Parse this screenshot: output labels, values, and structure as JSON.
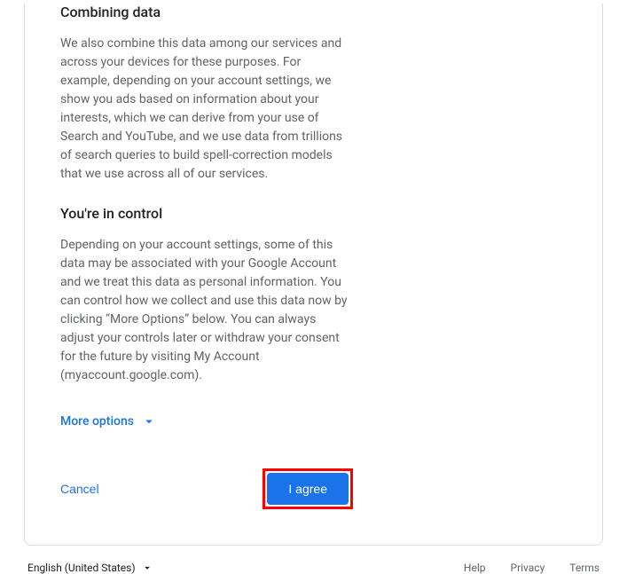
{
  "sections": {
    "combining": {
      "heading": "Combining data",
      "body": "We also combine this data among our services and across your devices for these purposes. For example, depending on your account settings, we show you ads based on information about your interests, which we can derive from your use of Search and YouTube, and we use data from trillions of search queries to build spell-correction models that we use across all of our services."
    },
    "control": {
      "heading": "You're in control",
      "body": "Depending on your account settings, some of this data may be associated with your Google Account and we treat this data as personal information. You can control how we collect and use this data now by clicking “More Options” below. You can always adjust your controls later or withdraw your consent for the future by visiting My Account (myaccount.google.com)."
    }
  },
  "more_options_label": "More options",
  "actions": {
    "cancel": "Cancel",
    "agree": "I agree"
  },
  "footer": {
    "language": "English (United States)",
    "links": {
      "help": "Help",
      "privacy": "Privacy",
      "terms": "Terms"
    }
  },
  "colors": {
    "accent": "#1a73e8",
    "highlight_border": "#ff0000"
  }
}
